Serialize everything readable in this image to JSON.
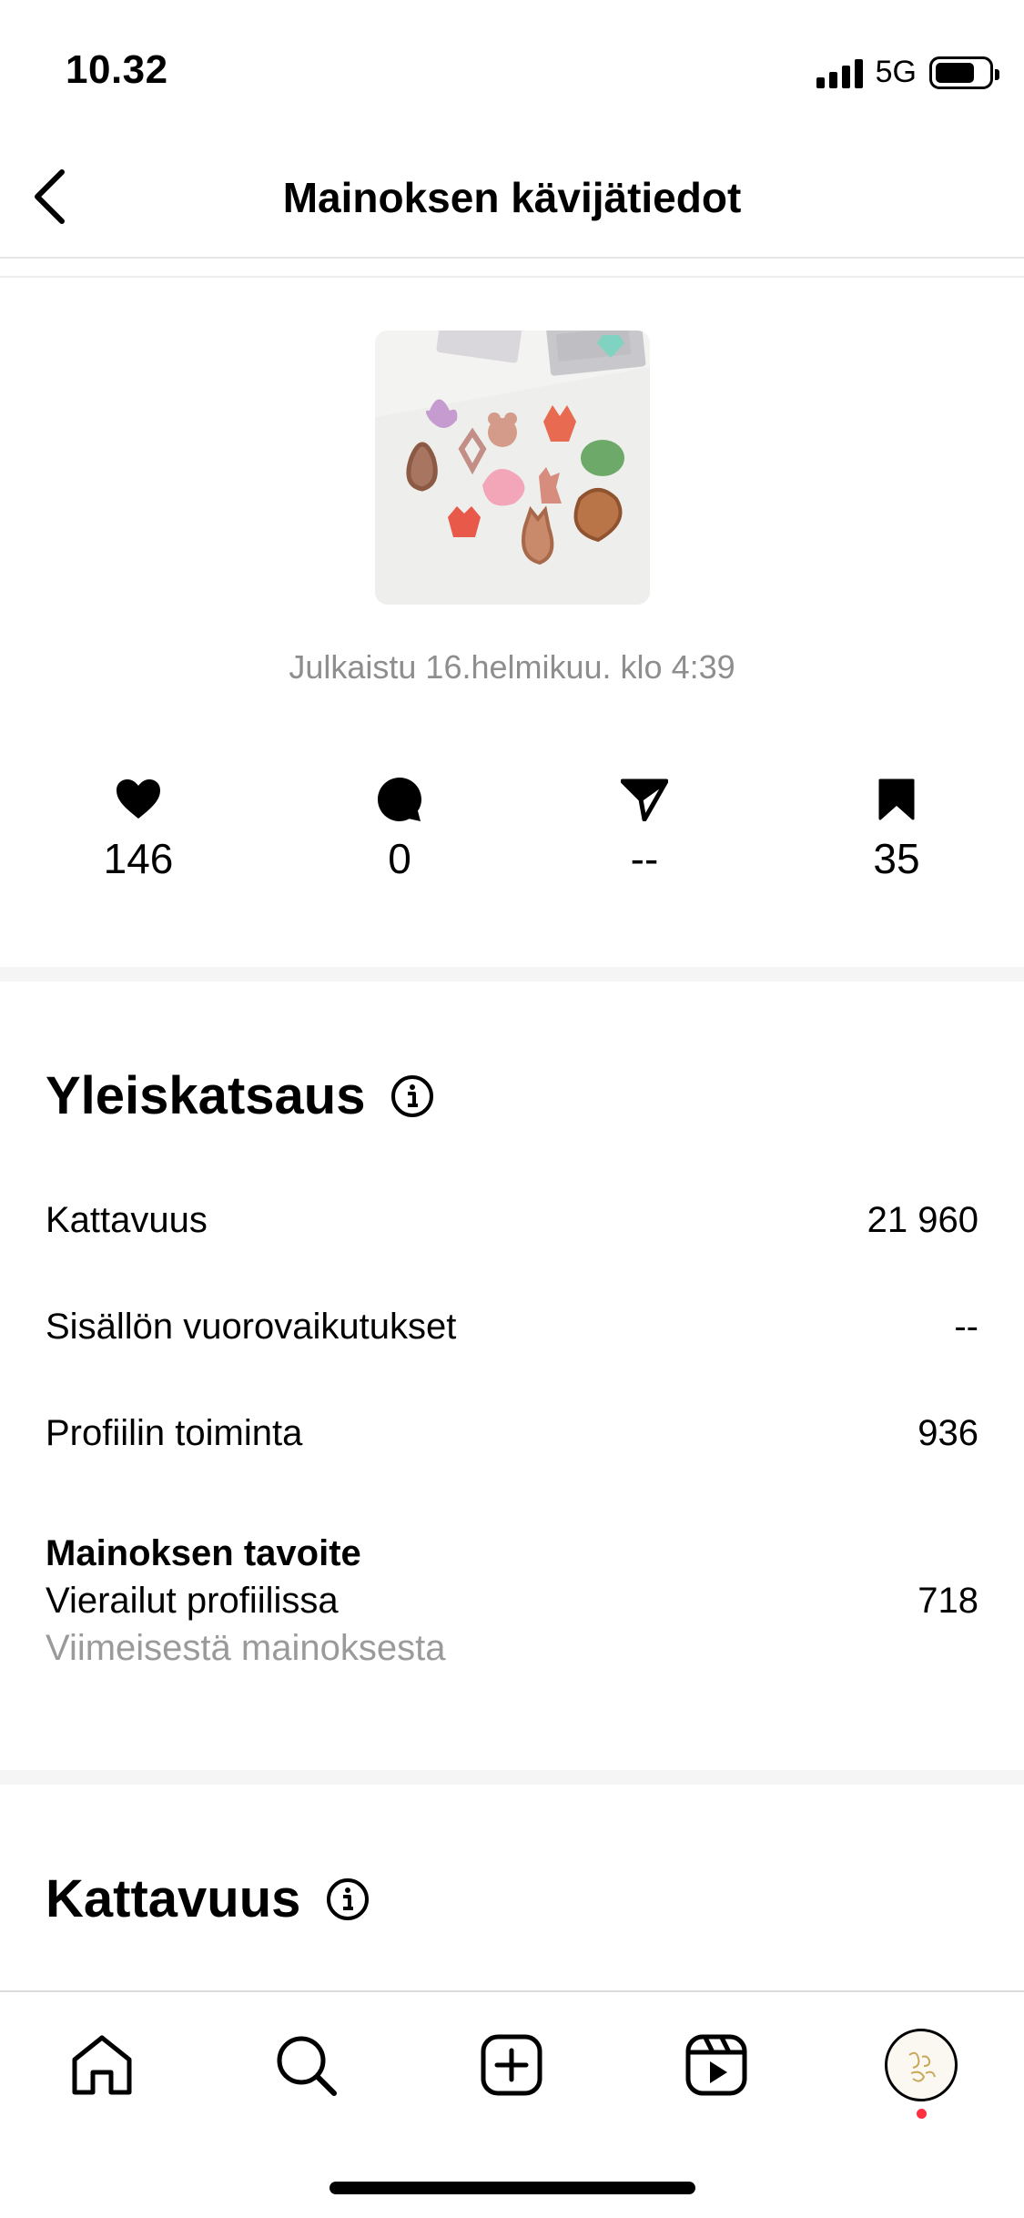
{
  "status_bar": {
    "time": "10.32",
    "network": "5G",
    "battery_level": 0.75
  },
  "header": {
    "title": "Mainoksen kävijätiedot"
  },
  "post": {
    "published": "Julkaistu 16.helmikuu. klo 4:39"
  },
  "stats": [
    {
      "icon": "heart-icon",
      "value": "146"
    },
    {
      "icon": "comment-icon",
      "value": "0"
    },
    {
      "icon": "share-icon",
      "value": "--"
    },
    {
      "icon": "bookmark-icon",
      "value": "35"
    }
  ],
  "overview": {
    "title": "Yleiskatsaus",
    "metrics": [
      {
        "label": "Kattavuus",
        "value": "21 960"
      },
      {
        "label": "Sisällön vuorovaikutukset",
        "value": "--"
      },
      {
        "label": "Profiilin toiminta",
        "value": "936"
      }
    ],
    "goal": {
      "title": "Mainoksen tavoite",
      "label": "Vierailut profiilissa",
      "note": "Viimeisestä mainoksesta",
      "value": "718"
    }
  },
  "reach": {
    "title": "Kattavuus"
  },
  "tab_bar": {
    "items": [
      "home-icon",
      "search-icon",
      "create-post-icon",
      "reels-icon",
      "profile-avatar"
    ],
    "has_notification": true
  },
  "colors": {
    "secondary_text": "#8e8e8e",
    "notification": "#ff3040",
    "separator": "#f5f5f5"
  }
}
